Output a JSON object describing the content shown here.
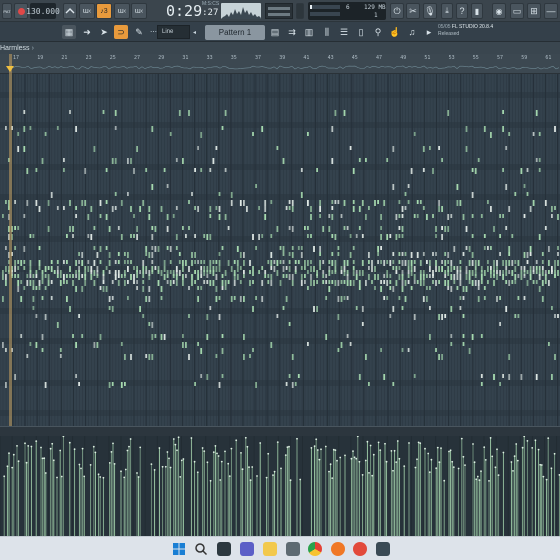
{
  "toolbar": {
    "tempo": "130.000",
    "pat_label": "PAT",
    "clock_main": "0:29",
    "clock_sub": ":27",
    "clock_unit": "M:S:CS",
    "cpu_value": "6",
    "memory": "129 MB",
    "polyphony": "1"
  },
  "toolbar2": {
    "snap_value": "Line",
    "pattern_name": "Pattern 1"
  },
  "news": {
    "date": "05/05",
    "title": "FL STUDIO 20.8.4",
    "subtitle": "Released"
  },
  "window": {
    "title": "Harmless",
    "title_suffix": "›"
  },
  "ruler": {
    "bars": [
      "17",
      "19",
      "21",
      "23",
      "25",
      "27",
      "29",
      "31",
      "33",
      "35",
      "37",
      "39",
      "41",
      "43",
      "45",
      "47",
      "49",
      "51",
      "53",
      "55",
      "57",
      "59",
      "61"
    ]
  },
  "icons": {
    "record": "record-icon",
    "metronome": "metronome-icon",
    "mixer": "mixer-icon",
    "help": "help-icon",
    "magnet": "magnet-icon",
    "windows": "windows-start-icon",
    "search": "search-icon"
  },
  "colors": {
    "accent": "#e89a3c",
    "note": "#a8dcb0",
    "velocity": "#a8d8b0",
    "background": "#33414c"
  }
}
